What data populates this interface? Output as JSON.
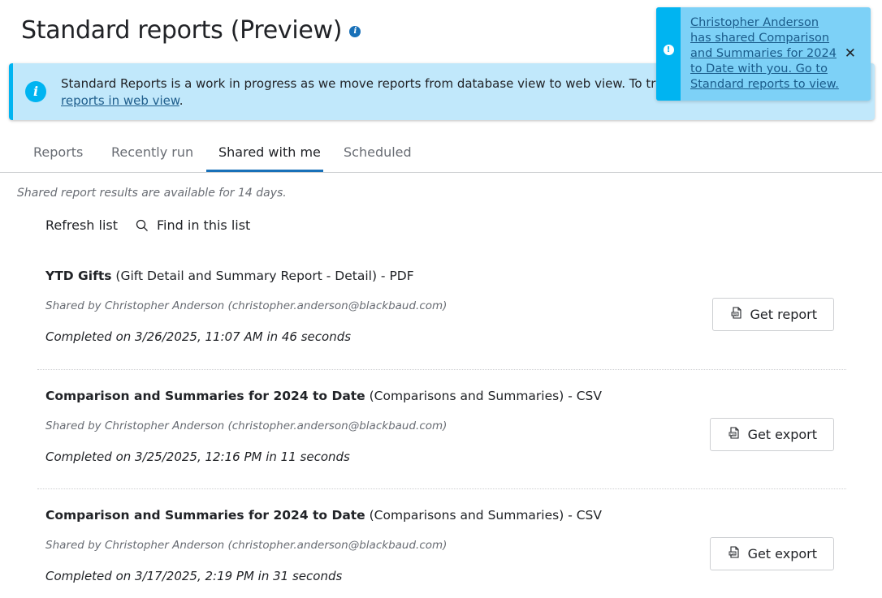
{
  "page": {
    "title": "Standard reports (Preview)"
  },
  "banner": {
    "text": "Standard Reports is a work in progress as we move reports from database view to web view. To track",
    "link_text": "reports in web view"
  },
  "toast": {
    "message": "Christopher Anderson has shared Comparison and Summaries for 2024 to Date with you. Go to Standard reports to view.",
    "close_symbol": "✕"
  },
  "tabs": [
    {
      "label": "Reports",
      "active": false
    },
    {
      "label": "Recently run",
      "active": false
    },
    {
      "label": "Shared with me",
      "active": true
    },
    {
      "label": "Scheduled",
      "active": false
    }
  ],
  "note": "Shared report results are available for 14 days.",
  "toolbar": {
    "refresh_label": "Refresh list",
    "find_label": "Find in this list"
  },
  "reports": [
    {
      "name": "YTD Gifts",
      "details": " (Gift Detail and Summary Report - Detail) - PDF",
      "shared_by": "Shared by Christopher Anderson (christopher.anderson@blackbaud.com)",
      "completed": "Completed on 3/26/2025, 11:07 AM in 46 seconds",
      "button_label": "Get report",
      "button_icon": "pdf-file-icon"
    },
    {
      "name": "Comparison and Summaries for 2024 to Date",
      "details": " (Comparisons and Summaries) - CSV",
      "shared_by": "Shared by Christopher Anderson (christopher.anderson@blackbaud.com)",
      "completed": "Completed on 3/25/2025, 12:16 PM in 11 seconds",
      "button_label": "Get export",
      "button_icon": "csv-file-icon"
    },
    {
      "name": "Comparison and Summaries for 2024 to Date",
      "details": " (Comparisons and Summaries) - CSV",
      "shared_by": "Shared by Christopher Anderson (christopher.anderson@blackbaud.com)",
      "completed": "Completed on 3/17/2025, 2:19 PM in 31 seconds",
      "button_label": "Get export",
      "button_icon": "csv-file-icon"
    }
  ],
  "colors": {
    "accent": "#1870b8",
    "banner_bg": "#c1e8fb",
    "info_blue": "#00b4f1",
    "toast_bg": "#7dd1f7"
  }
}
